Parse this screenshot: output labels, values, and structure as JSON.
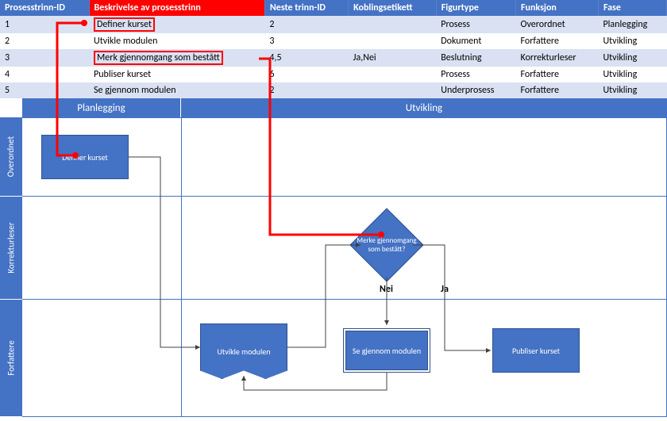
{
  "table": {
    "headers": {
      "h0": "Prosesstrinn-ID",
      "h1": "Beskrivelse av prosesstrinn",
      "h2": "Neste trinn-ID",
      "h3": "Koblingsetikett",
      "h4": "Figurtype",
      "h5": "Funksjon",
      "h6": "Fase"
    },
    "rows": [
      {
        "id": "1",
        "desc": "Definer kurset",
        "next": "2",
        "conn": "",
        "shape": "Prosess",
        "role": "Overordnet",
        "phase": "Planlegging",
        "hl": true
      },
      {
        "id": "2",
        "desc": "Utvikle modulen",
        "next": "3",
        "conn": "",
        "shape": "Dokument",
        "role": "Forfattere",
        "phase": "Utvikling",
        "hl": false
      },
      {
        "id": "3",
        "desc": "Merk gjennomgang som bestått",
        "next": "4,5",
        "conn": "Ja,Nei",
        "shape": "Beslutning",
        "role": "Korrekturleser",
        "phase": "Utvikling",
        "hl": true
      },
      {
        "id": "4",
        "desc": "Publiser kurset",
        "next": "6",
        "conn": "",
        "shape": "Prosess",
        "role": "Forfattere",
        "phase": "Utvikling",
        "hl": false
      },
      {
        "id": "5",
        "desc": "Se gjennom modulen",
        "next": "2",
        "conn": "",
        "shape": "Underprosess",
        "role": "Forfattere",
        "phase": "Utvikling",
        "hl": false
      }
    ]
  },
  "phases": {
    "plan": "Planlegging",
    "dev": "Utvikling"
  },
  "lanes": {
    "l0": "Overordnet",
    "l1": "Korrekturleser",
    "l2": "Forfattere"
  },
  "shapes": {
    "define": "Definer kurset",
    "develop": "Utvikle modulen",
    "decision": "Merke gjennomgang som bestått?",
    "review": "Se gjennom modulen",
    "publish": "Publiser kurset"
  },
  "labels": {
    "no": "Nei",
    "yes": "Ja"
  }
}
